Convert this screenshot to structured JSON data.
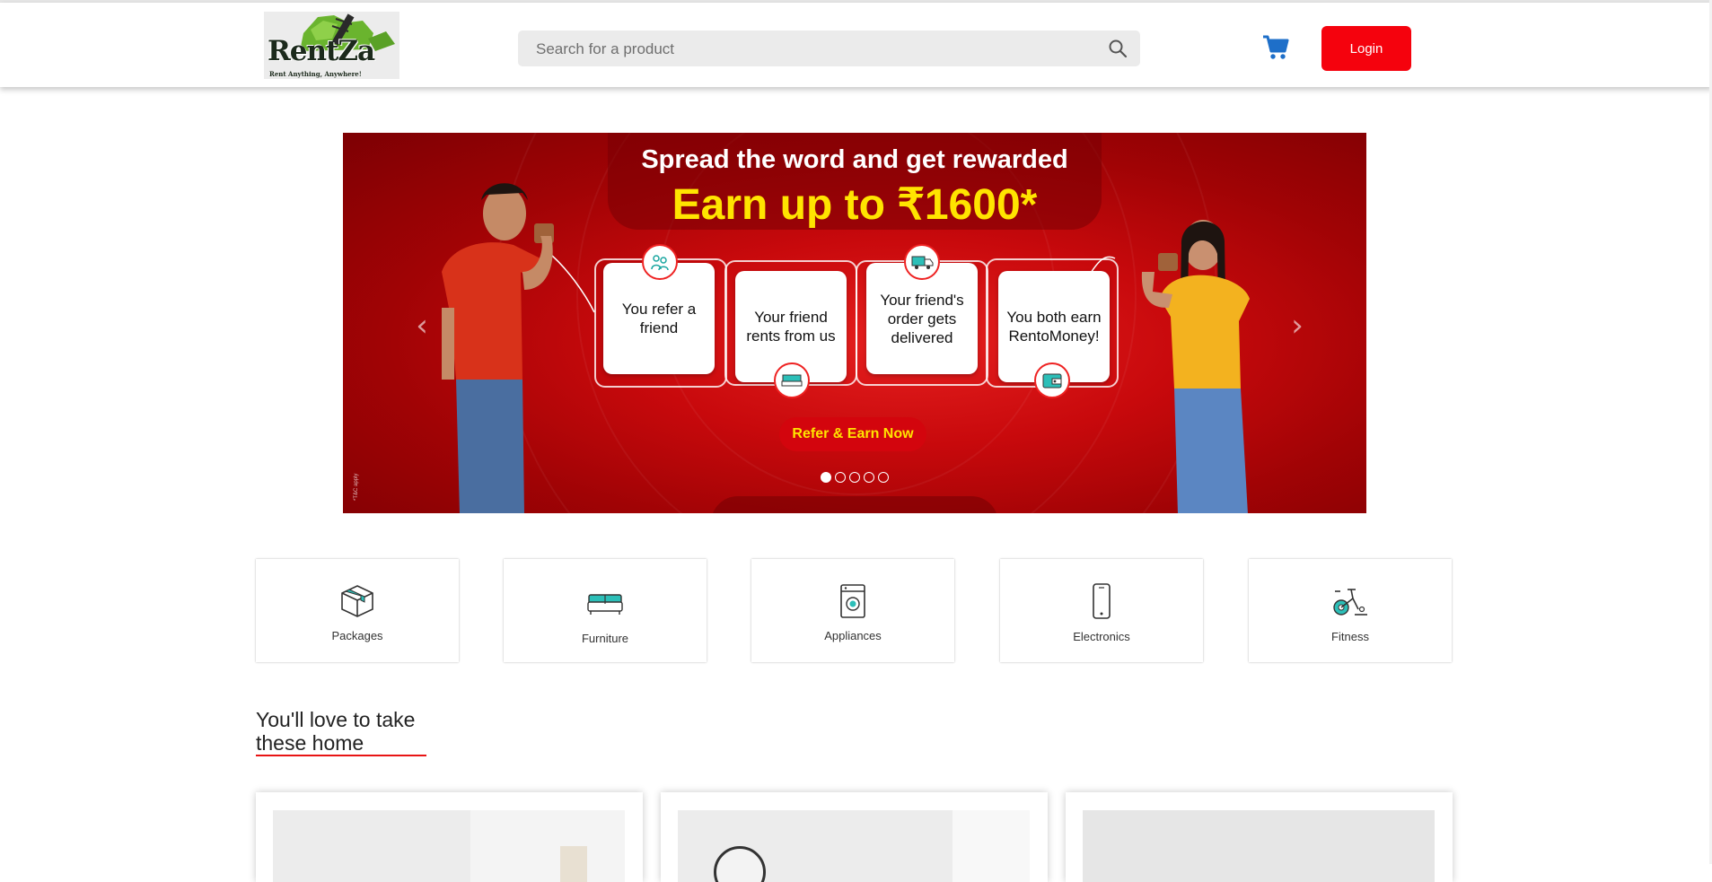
{
  "header": {
    "logo": {
      "brand": "RentZa",
      "tagline": "Rent Anything, Anywhere!"
    },
    "search": {
      "placeholder": "Search for a product",
      "value": "",
      "icon": "search-icon"
    },
    "cart_icon": "cart-icon",
    "login_label": "Login",
    "colors": {
      "login_bg": "#f5020d",
      "cart": "#1e6fc9"
    }
  },
  "banner": {
    "title": "Spread the word and get rewarded",
    "subtitle": "Earn up to ₹1600*",
    "steps": [
      {
        "label": "You refer a friend",
        "icon": "refer-friends-icon"
      },
      {
        "label": "Your friend rents from us",
        "icon": "bed-icon"
      },
      {
        "label": "Your friend's order gets delivered",
        "icon": "delivery-truck-icon"
      },
      {
        "label": "You both earn RentoMoney!",
        "icon": "wallet-icon"
      }
    ],
    "cta_label": "Refer & Earn Now",
    "terms": "*T&C apply",
    "slide_count": 5,
    "active_slide": 1,
    "colors": {
      "bg": "#c8090c",
      "highlight": "#ffe400"
    }
  },
  "categories": [
    {
      "label": "Packages",
      "icon": "package-icon"
    },
    {
      "label": "Furniture",
      "icon": "sofa-icon"
    },
    {
      "label": "Appliances",
      "icon": "appliance-icon"
    },
    {
      "label": "Electronics",
      "icon": "phone-icon"
    },
    {
      "label": "Fitness",
      "icon": "exercise-bike-icon"
    }
  ],
  "section": {
    "title_line1": "You'll love to take",
    "title_line2": "these home",
    "underline_color": "#e81414"
  }
}
